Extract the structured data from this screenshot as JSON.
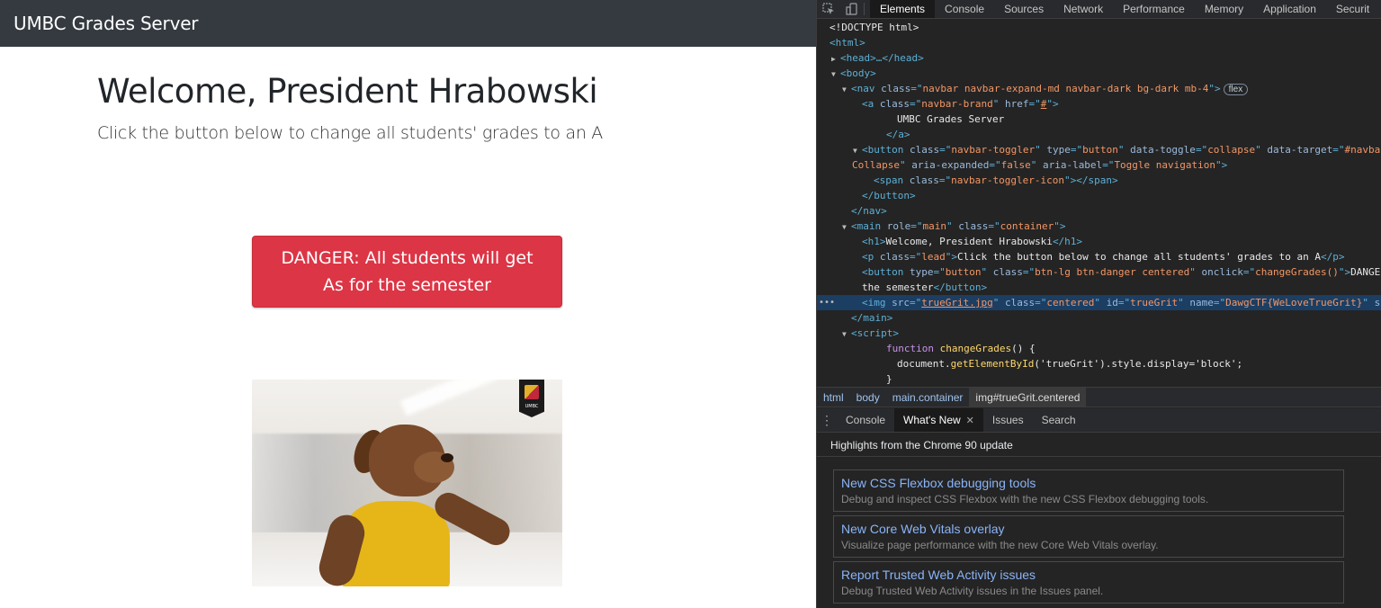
{
  "site": {
    "navbar": {
      "brand": "UMBC Grades Server"
    },
    "heading": "Welcome, President Hrabowski",
    "lead": "Click the button below to change all students' grades to an A",
    "danger_button": "DANGER: All students will get As for the semester",
    "image": {
      "alt": "UMBC mascot True Grit",
      "badge_text": "UMBC"
    },
    "colors": {
      "navbar": "#343a40",
      "danger": "#dc3545"
    }
  },
  "devtools": {
    "toolbar_icons": [
      "inspect-icon",
      "device-toggle-icon"
    ],
    "tabs": [
      "Elements",
      "Console",
      "Sources",
      "Network",
      "Performance",
      "Memory",
      "Application",
      "Securit"
    ],
    "active_tab": "Elements",
    "dom": {
      "doctype": "<!DOCTYPE html>",
      "html_open": "<html>",
      "head": "<head>…</head>",
      "body_open": "<body>",
      "nav_open_tag": "nav",
      "nav_class": "navbar navbar-expand-md navbar-dark bg-dark mb-4",
      "flex_badge": "flex",
      "a_class": "navbar-brand",
      "a_href": "#",
      "a_text": "UMBC Grades Server",
      "a_close": "</a>",
      "button_class": "navbar-toggler",
      "button_type": "button",
      "button_toggle": "collapse",
      "button_target": "#navbar",
      "button_target_cont": "Collapse",
      "button_expanded": "false",
      "button_label": "Toggle navigation",
      "span_class": "navbar-toggler-icon",
      "button_close": "</button>",
      "nav_close": "</nav>",
      "main_role": "main",
      "main_class": "container",
      "h1_text": "Welcome, President Hrabowski",
      "p_class": "lead",
      "p_text": "Click the button below to change all students' grades to an A",
      "btn_type": "button",
      "btn_class": "btn-lg btn-danger centered",
      "btn_onclick": "changeGrades()",
      "btn_text_start": "DANGER",
      "btn_text_cont": "the semester",
      "img_src": "trueGrit.jpg",
      "img_class": "centered",
      "img_id": "trueGrit",
      "img_name": "DawgCTF{WeLoveTrueGrit}",
      "img_trail": "st",
      "main_close": "</main>",
      "script_open": "<script>",
      "func_kw": "function",
      "func_name": "changeGrades",
      "func_rest": "() {",
      "stmt_obj": "document.",
      "stmt_fn": "getElementById",
      "stmt_arg": "('trueGrit').style.display='block';",
      "brace_close": "}"
    },
    "breadcrumbs": [
      "html",
      "body",
      "main.container",
      "img#trueGrit.centered"
    ],
    "drawer_tabs": [
      "Console",
      "What's New",
      "Issues",
      "Search"
    ],
    "drawer_active": "What's New",
    "highlights_title": "Highlights from the Chrome 90 update",
    "cards": [
      {
        "title": "New CSS Flexbox debugging tools",
        "desc": "Debug and inspect CSS Flexbox with the new CSS Flexbox debugging tools."
      },
      {
        "title": "New Core Web Vitals overlay",
        "desc": "Visualize page performance with the new Core Web Vitals overlay."
      },
      {
        "title": "Report Trusted Web Activity issues",
        "desc": "Debug Trusted Web Activity issues in the Issues panel."
      }
    ]
  }
}
